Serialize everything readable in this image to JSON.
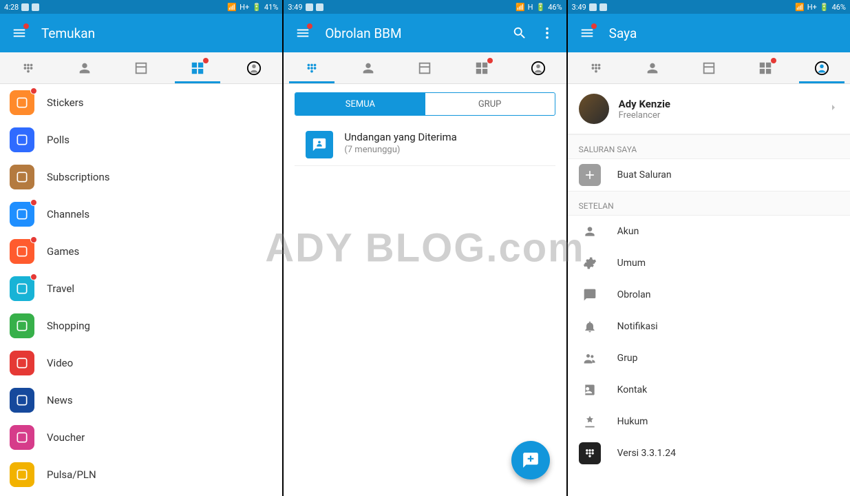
{
  "watermark": "ADY BLOG.com",
  "phone1": {
    "status": {
      "time": "4:28",
      "net": "H+",
      "battery": "41%"
    },
    "title": "Temukan",
    "tabs": {
      "activeIndex": 3
    },
    "discover": [
      {
        "label": "Stickers",
        "color": "#ff8a2b",
        "badge": true,
        "icon": "sticker"
      },
      {
        "label": "Polls",
        "color": "#2f6bff",
        "badge": false,
        "icon": "poll"
      },
      {
        "label": "Subscriptions",
        "color": "#b47a3f",
        "badge": false,
        "icon": "sub"
      },
      {
        "label": "Channels",
        "color": "#1f8fff",
        "badge": true,
        "icon": "channels"
      },
      {
        "label": "Games",
        "color": "#ff5b2e",
        "badge": true,
        "icon": "games"
      },
      {
        "label": "Travel",
        "color": "#18b3d6",
        "badge": true,
        "icon": "travel"
      },
      {
        "label": "Shopping",
        "color": "#37b04a",
        "badge": false,
        "icon": "shopping"
      },
      {
        "label": "Video",
        "color": "#e53935",
        "badge": false,
        "icon": "video"
      },
      {
        "label": "News",
        "color": "#16499c",
        "badge": false,
        "icon": "news"
      },
      {
        "label": "Voucher",
        "color": "#d63c8a",
        "badge": false,
        "icon": "voucher"
      },
      {
        "label": "Pulsa/PLN",
        "color": "#f2b200",
        "badge": false,
        "icon": "pulsa"
      }
    ]
  },
  "phone2": {
    "status": {
      "time": "3:49",
      "net": "H",
      "battery": "46%"
    },
    "title": "Obrolan BBM",
    "tabs": {
      "activeIndex": 0
    },
    "segments": {
      "all": "SEMUA",
      "group": "GRUP",
      "activeIndex": 0
    },
    "invite": {
      "title": "Undangan yang Diterima",
      "sub": "(7 menunggu)"
    }
  },
  "phone3": {
    "status": {
      "time": "3:49",
      "net": "H+",
      "battery": "46%"
    },
    "title": "Saya",
    "tabs": {
      "activeIndex": 4
    },
    "profile": {
      "name": "Ady Kenzie",
      "sub": "Freelancer"
    },
    "sections": {
      "channel_header": "SALURAN SAYA",
      "create_channel": "Buat Saluran",
      "settings_header": "SETELAN",
      "items": [
        {
          "label": "Akun",
          "icon": "user"
        },
        {
          "label": "Umum",
          "icon": "gear"
        },
        {
          "label": "Obrolan",
          "icon": "chat"
        },
        {
          "label": "Notifikasi",
          "icon": "bell"
        },
        {
          "label": "Grup",
          "icon": "group"
        },
        {
          "label": "Kontak",
          "icon": "contact"
        },
        {
          "label": "Hukum",
          "icon": "legal"
        }
      ],
      "version": "Versi 3.3.1.24"
    }
  }
}
